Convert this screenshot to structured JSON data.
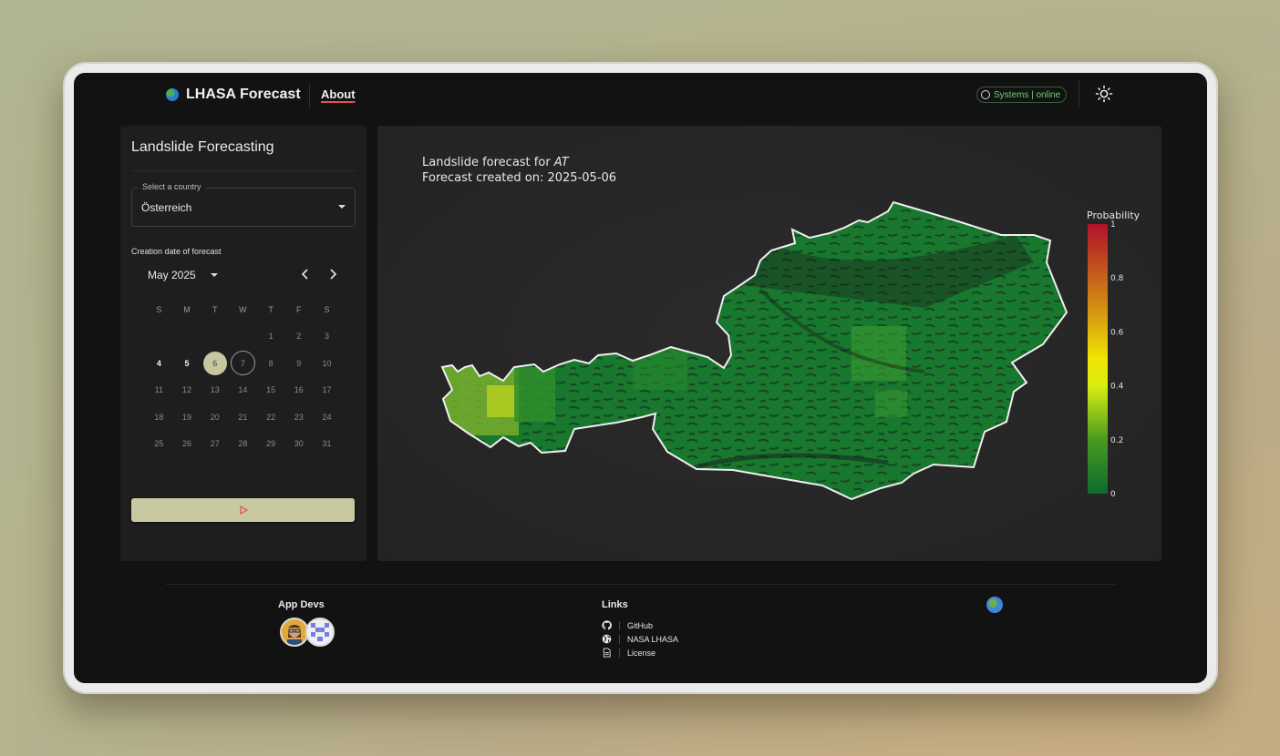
{
  "app": {
    "title": "LHASA Forecast",
    "nav_about": "About",
    "status": "Systems | online"
  },
  "panel": {
    "title": "Landslide Forecasting",
    "country_label": "Select a country",
    "country_value": "Österreich",
    "date_label": "Creation date of forecast",
    "month": "May 2025",
    "weekdays": [
      "S",
      "M",
      "T",
      "W",
      "T",
      "F",
      "S"
    ],
    "weeks": [
      [
        "",
        "",
        "",
        "",
        "1",
        "2",
        "3"
      ],
      [
        "4",
        "5",
        "6",
        "7",
        "8",
        "9",
        "10"
      ],
      [
        "11",
        "12",
        "13",
        "14",
        "15",
        "16",
        "17"
      ],
      [
        "18",
        "19",
        "20",
        "21",
        "22",
        "23",
        "24"
      ],
      [
        "25",
        "26",
        "27",
        "28",
        "29",
        "30",
        "31"
      ]
    ],
    "selected_day": "6",
    "today_day": "7",
    "available_days": [
      "4",
      "5",
      "6"
    ]
  },
  "map": {
    "title_prefix": "Landslide forecast for ",
    "country_code": "AT",
    "created_line": "Forecast created on: 2025-05-06"
  },
  "chart_data": {
    "type": "heatmap",
    "title": "Landslide forecast for AT",
    "subtitle": "Forecast created on: 2025-05-06",
    "colorbar_title": "Probability",
    "colorbar_ticks": [
      "0",
      "0.2",
      "0.4",
      "0.6",
      "0.8",
      "1"
    ],
    "range": [
      0,
      1
    ],
    "colorscale": [
      "#0d6b2e",
      "#4a9a20",
      "#d8ee10",
      "#f2e406",
      "#d7a010",
      "#c25a1c",
      "#b0122a"
    ]
  },
  "footer": {
    "devs_heading": "App Devs",
    "links_heading": "Links",
    "links": [
      "GitHub",
      "NASA LHASA",
      "License"
    ]
  },
  "icons": [
    "globe-icon",
    "sun-icon",
    "chevron-left-icon",
    "chevron-right-icon",
    "play-icon",
    "github-icon",
    "web-icon",
    "document-icon"
  ],
  "colors": {
    "accent": "#c9c9a1",
    "status": "#6fcf6f",
    "underline": "#e0534a"
  }
}
